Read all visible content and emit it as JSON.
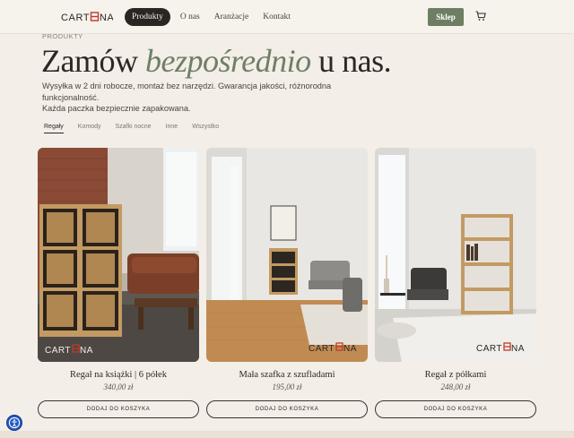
{
  "header": {
    "logo_text": "CARTENA",
    "nav": [
      {
        "label": "Produkty",
        "active": true
      },
      {
        "label": "O nas",
        "active": false
      },
      {
        "label": "Aranżacje",
        "active": false
      },
      {
        "label": "Kontakt",
        "active": false
      }
    ],
    "shop_button": "Sklep",
    "cart_icon": "cart-icon"
  },
  "hero": {
    "eyebrow": "PRODUKTY",
    "headline_part1": "Zamów ",
    "headline_accent": "bezpośrednio",
    "headline_part2": " u nas.",
    "lead_line1": "Wysyłka w 2 dni robocze, montaż bez narzędzi. Gwarancja jakości, różnorodna funkcjonalność.",
    "lead_line2": "Każda paczka bezpiecznie zapakowana."
  },
  "tabs": [
    {
      "label": "Regały",
      "active": true
    },
    {
      "label": "Komody",
      "active": false
    },
    {
      "label": "Szafki nocne",
      "active": false
    },
    {
      "label": "Inne",
      "active": false
    },
    {
      "label": "Wszystko",
      "active": false
    }
  ],
  "products": [
    {
      "title": "Regał na książki | 6 półek",
      "price": "340,00 zł",
      "button": "DODAJ DO KOSZYKA",
      "watermark": "CARTENA"
    },
    {
      "title": "Mała szafka z szufladami",
      "price": "195,00 zł",
      "button": "DODAJ DO KOSZYKA",
      "watermark": "CARTENA"
    },
    {
      "title": "Regał z półkami",
      "price": "248,00 zł",
      "button": "DODAJ DO KOSZYKA",
      "watermark": "CARTENA"
    }
  ],
  "colors": {
    "accent_green": "#6d7e63",
    "dark": "#2a2624",
    "background": "#f3eee7",
    "logo_red": "#c0392b"
  }
}
